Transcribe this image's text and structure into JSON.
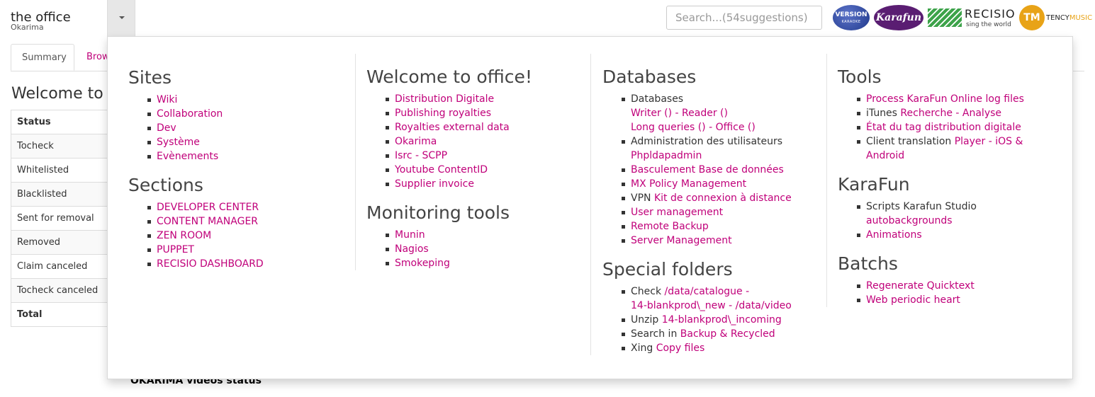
{
  "header": {
    "title": "the office",
    "subtitle": "Okarima",
    "search_placeholder": "Search...(54suggestions)",
    "logos": {
      "version": "VERSION",
      "version_sub": "KARAOKE",
      "karafun": "Karafun",
      "recisio": "RECISIO",
      "recisio_tag": "sing the world",
      "tency_mark": "TM",
      "tency_a": "TENCY",
      "tency_b": "MUSIC"
    }
  },
  "page": {
    "tabs": [
      "Summary",
      "Brow"
    ],
    "heading": "Welcome to ",
    "table": {
      "header": "Status",
      "rows": [
        "Tocheck",
        "Whitelisted",
        "Blacklisted",
        "Sent for removal",
        "Removed",
        "Claim canceled",
        "Tocheck canceled"
      ],
      "total": "Total"
    },
    "videos_heading": "OKARIMA videos status"
  },
  "menu": {
    "sites": {
      "title": "Sites",
      "items": [
        "Wiki",
        "Collaboration",
        "Dev",
        "Système",
        "Evènements"
      ]
    },
    "sections": {
      "title": "Sections",
      "items": [
        "DEVELOPER CENTER",
        "CONTENT MANAGER",
        "ZEN ROOM",
        "PUPPET",
        "RECISIO DASHBOARD"
      ]
    },
    "welcome": {
      "title": "Welcome to office!",
      "items": [
        "Distribution Digitale",
        "Publishing royalties",
        "Royalties external data",
        "Okarima",
        "Isrc - SCPP",
        "Youtube ContentID",
        "Supplier invoice"
      ]
    },
    "monitoring": {
      "title": "Monitoring tools",
      "items": [
        "Munin",
        "Nagios",
        "Smokeping"
      ]
    },
    "databases": {
      "title": "Databases",
      "db_label": "Databases",
      "writer": "Writer ()",
      "reader": "Reader ()",
      "long_queries": "Long queries ()",
      "office": "Office ()",
      "admin_label": "Administration des utilisateurs",
      "phpldapadmin": "Phpldapadmin",
      "basculement": "Basculement Base de données",
      "mx_policy": "MX Policy Management",
      "vpn_label": "VPN",
      "vpn_kit": "Kit de connexion à distance",
      "user_management": "User management",
      "remote_backup": "Remote Backup",
      "server_management": "Server Management"
    },
    "special": {
      "title": "Special folders",
      "check_label": "Check",
      "catalogue": "/data/catalogue",
      "blankprod_new": "14-blankprod\\_new",
      "data_video": "/data/video",
      "unzip_label": "Unzip",
      "blankprod_incoming": "14-blankprod\\_incoming",
      "search_label": "Search in",
      "backup": "Backup & Recycled",
      "xing_label": "Xing",
      "copy_files": "Copy files"
    },
    "tools": {
      "title": "Tools",
      "process_log": "Process KaraFun Online log files",
      "itunes_label": "iTunes",
      "recherche": "Recherche",
      "analyse": "Analyse",
      "etat_tag": "État du tag distribution digitale",
      "client_translation": "Client translation",
      "player": "Player",
      "ios_android": "iOS & Android"
    },
    "karafun": {
      "title": "KaraFun",
      "scripts_label": "Scripts Karafun Studio",
      "autobackgrounds": "autobackgrounds",
      "animations": "Animations"
    },
    "batchs": {
      "title": "Batchs",
      "items": [
        "Regenerate Quicktext",
        "Web periodic heart"
      ]
    },
    "sep": " - "
  }
}
